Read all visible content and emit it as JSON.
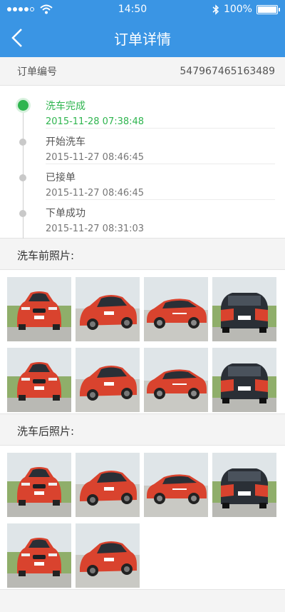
{
  "status_bar": {
    "time": "14:50",
    "battery": "100%",
    "battery_level": 1.0
  },
  "header": {
    "title": "订单详情"
  },
  "order": {
    "label": "订单编号",
    "number": "547967465163489"
  },
  "timeline": [
    {
      "status": "洗车完成",
      "time": "2015-11-28 07:38:48",
      "active": true
    },
    {
      "status": "开始洗车",
      "time": " 2015-11-27 08:46:45",
      "active": false
    },
    {
      "status": "已接单",
      "time": "2015-11-27 08:46:45",
      "active": false
    },
    {
      "status": "下单成功",
      "time": "2015-11-27 08:31:03",
      "active": false
    }
  ],
  "before_section": {
    "title": "洗车前照片:"
  },
  "after_section": {
    "title": "洗车后照片:"
  },
  "colors": {
    "brand": "#3a95e4",
    "active": "#2fb54f",
    "car": "#d9432e"
  }
}
